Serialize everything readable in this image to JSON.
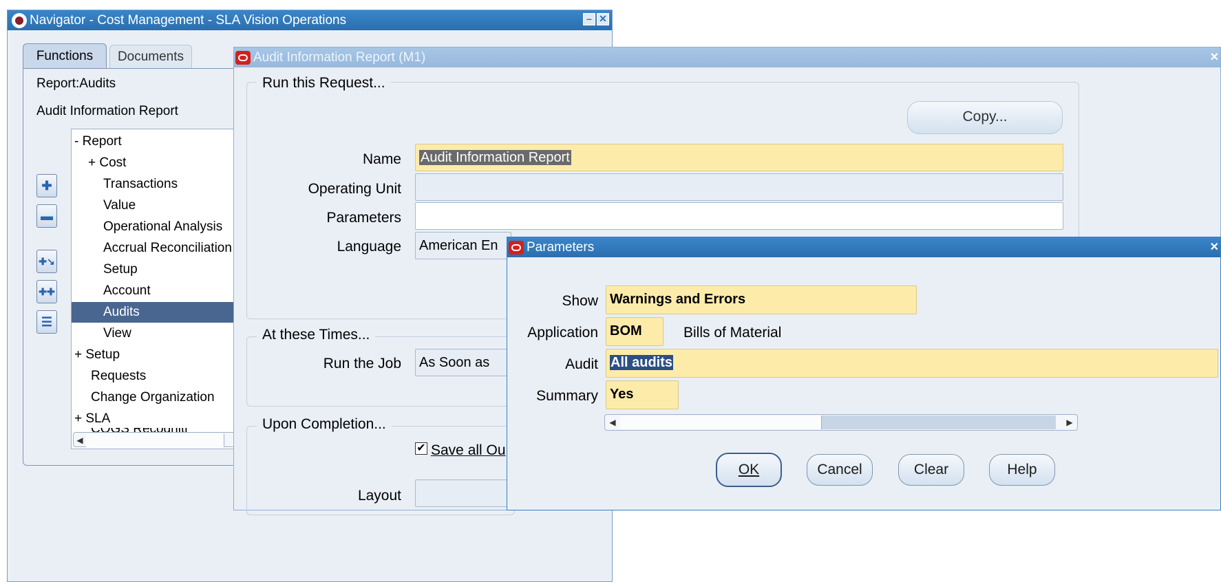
{
  "navigator": {
    "title": "Navigator - Cost Management - SLA Vision Operations",
    "tabs": [
      "Functions",
      "Documents"
    ],
    "breadcrumb": "Report:Audits",
    "selected_function": "Audit Information Report",
    "tree": [
      {
        "label": "- Report"
      },
      {
        "label": "+ Cost"
      },
      {
        "label": "Transactions"
      },
      {
        "label": "Value"
      },
      {
        "label": "Operational Analysis"
      },
      {
        "label": "Accrual Reconciliation"
      },
      {
        "label": "Setup"
      },
      {
        "label": "Account"
      },
      {
        "label": "Audits"
      },
      {
        "label": "View"
      },
      {
        "label": "+ Setup"
      },
      {
        "label": "Requests"
      },
      {
        "label": "Change Organization"
      },
      {
        "label": "+ SLA"
      },
      {
        "label": "COGS Recogniti"
      }
    ]
  },
  "report": {
    "title": "Audit Information Report (M1)",
    "run_group": "Run this Request...",
    "copy_button": "Copy...",
    "name_label": "Name",
    "name_value": "Audit Information Report",
    "operating_unit_label": "Operating Unit",
    "operating_unit_value": "",
    "parameters_label": "Parameters",
    "parameters_value": "",
    "language_label": "Language",
    "language_value": "American En",
    "times_group": "At these Times...",
    "run_job_label": "Run the Job",
    "run_job_value": "As Soon as",
    "completion_group": "Upon Completion...",
    "save_output_label": "Save all Ou",
    "layout_label": "Layout"
  },
  "parameters": {
    "title": "Parameters",
    "show_label": "Show",
    "show_value": "Warnings and Errors",
    "application_label": "Application",
    "application_value": "BOM",
    "application_desc": "Bills of Material",
    "audit_label": "Audit",
    "audit_value": "All audits",
    "summary_label": "Summary",
    "summary_value": "Yes",
    "buttons": {
      "ok": "OK",
      "cancel": "Cancel",
      "clear": "Clear",
      "help": "Help"
    }
  },
  "colors": {
    "titlebar_active": "#2a6fb0",
    "selection": "#48668f",
    "field_required": "#fdebaa"
  }
}
